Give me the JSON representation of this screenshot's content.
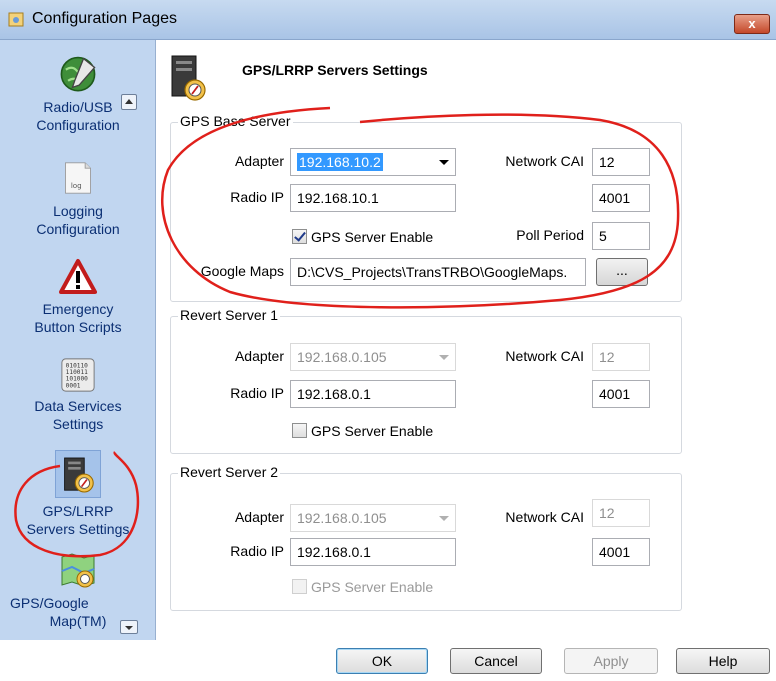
{
  "window": {
    "title": "Configuration Pages",
    "close_symbol": "x"
  },
  "sidebar": {
    "items": [
      {
        "line1": "Radio/USB",
        "line2": "Configuration",
        "icon": "globe-pencil-icon"
      },
      {
        "line1": "Logging",
        "line2": "Configuration",
        "icon": "log-file-icon",
        "icon_text": "log"
      },
      {
        "line1": "Emergency",
        "line2": "Button Scripts",
        "icon": "warning-triangle-icon"
      },
      {
        "line1": "Data Services",
        "line2": "Settings",
        "icon": "binary-data-icon",
        "icon_text": "010110\n110011\n101000\n0001"
      },
      {
        "line1": "GPS/LRRP",
        "line2": "Servers Settings",
        "icon": "gps-server-icon",
        "selected": true
      },
      {
        "line1": "GPS/Google",
        "line2": "Map(TM)",
        "icon": "map-icon"
      }
    ]
  },
  "page": {
    "title": "GPS/LRRP Servers Settings"
  },
  "labels": {
    "adapter": "Adapter",
    "radio_ip": "Radio IP",
    "network_cai": "Network CAI",
    "poll_period": "Poll Period",
    "google_maps": "Google Maps",
    "gps_server_enable": "GPS Server Enable"
  },
  "gps_base_server": {
    "legend": "GPS Base Server",
    "adapter": "192.168.10.2",
    "radio_ip": "192.168.10.1",
    "network_cai": "12",
    "port": "4001",
    "gps_server_enable": true,
    "poll_period": "5",
    "google_maps_path": "D:\\CVS_Projects\\TransTRBO\\GoogleMaps.",
    "browse_label": "..."
  },
  "revert_server_1": {
    "legend": "Revert Server 1",
    "adapter": "192.168.0.105",
    "radio_ip": "192.168.0.1",
    "network_cai": "12",
    "port": "4001",
    "gps_server_enable": false
  },
  "revert_server_2": {
    "legend": "Revert Server 2",
    "adapter": "192.168.0.105",
    "radio_ip": "192.168.0.1",
    "network_cai": "12",
    "port": "4001",
    "gps_server_enable": false
  },
  "buttons": {
    "ok": "OK",
    "cancel": "Cancel",
    "apply": "Apply",
    "help": "Help"
  },
  "colors": {
    "sidebar_bg": "#c1d6f0",
    "sidebar_text": "#0b2f73",
    "annotation_red": "#e0201b",
    "selection_blue": "#3399ff"
  }
}
